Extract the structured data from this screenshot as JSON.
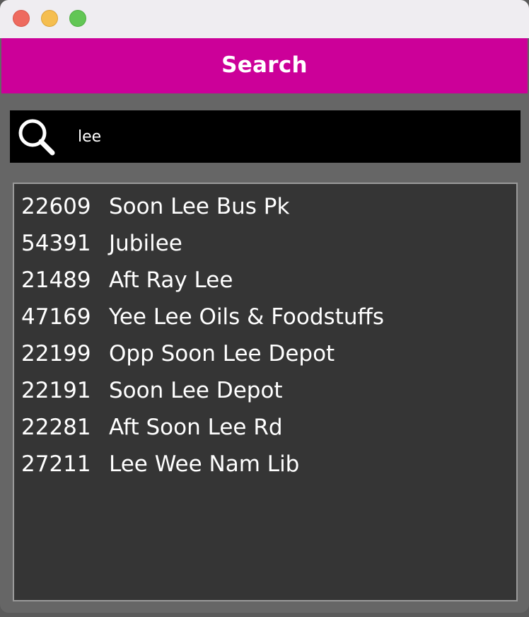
{
  "window": {
    "controls": [
      "close",
      "minimize",
      "maximize"
    ]
  },
  "header": {
    "title": "Search",
    "background": "#cc0099"
  },
  "search": {
    "icon": "search-icon",
    "value": "lee",
    "placeholder": ""
  },
  "results": [
    {
      "code": "22609",
      "name": "Soon Lee Bus Pk"
    },
    {
      "code": "54391",
      "name": "Jubilee"
    },
    {
      "code": "21489",
      "name": "Aft Ray Lee"
    },
    {
      "code": "47169",
      "name": "Yee Lee Oils & Foodstuffs"
    },
    {
      "code": "22199",
      "name": "Opp Soon Lee Depot"
    },
    {
      "code": "22191",
      "name": "Soon Lee Depot"
    },
    {
      "code": "22281",
      "name": "Aft Soon Lee Rd"
    },
    {
      "code": "27211",
      "name": "Lee Wee Nam Lib"
    }
  ]
}
